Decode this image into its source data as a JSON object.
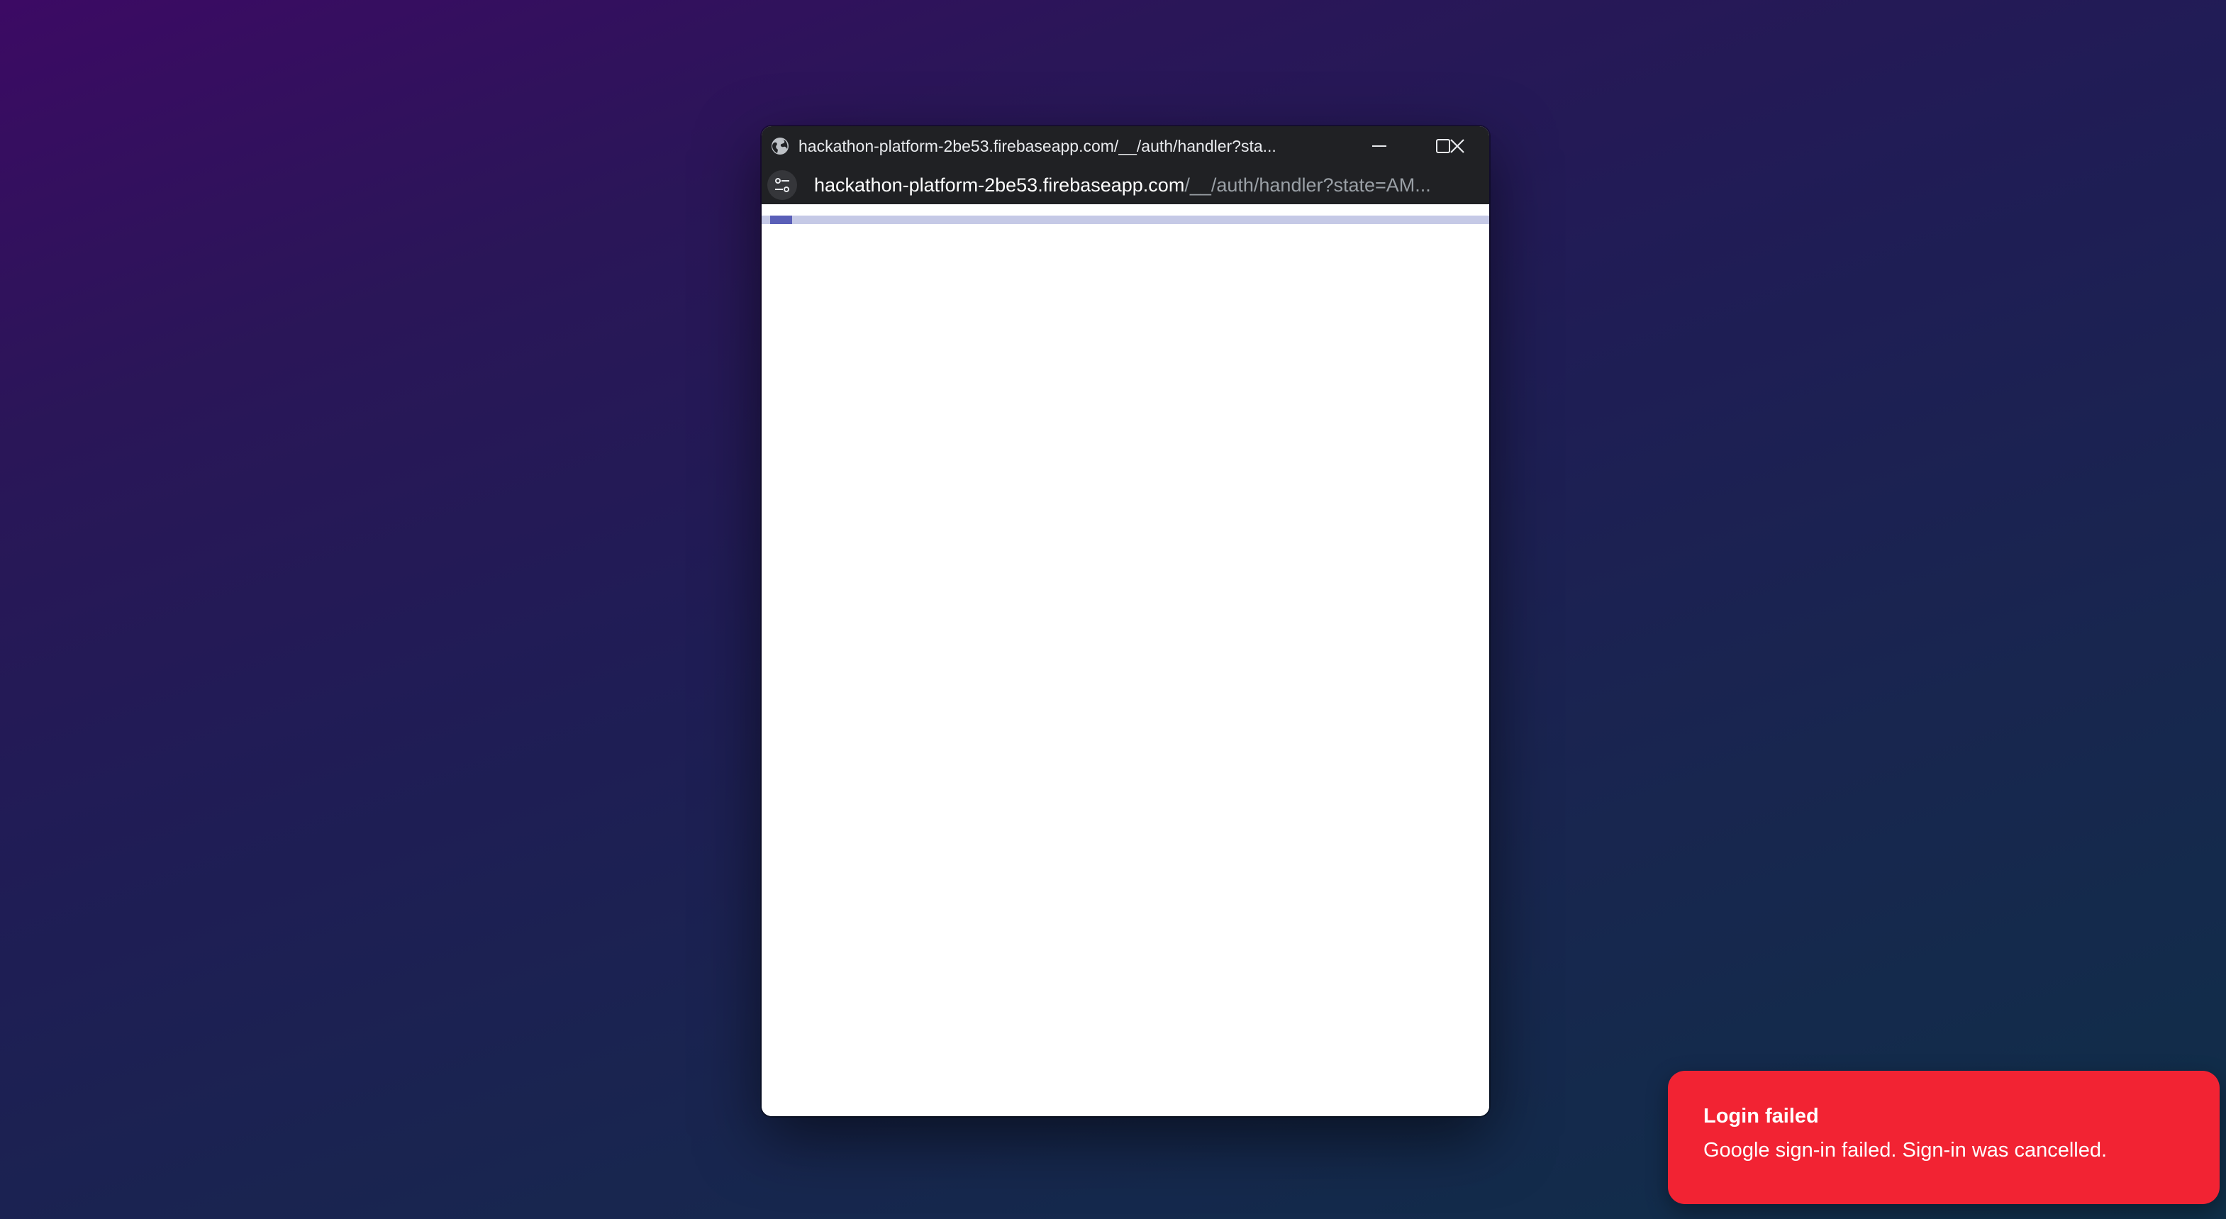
{
  "popup": {
    "window_title": "hackathon-platform-2be53.firebaseapp.com/__/auth/handler?sta...",
    "url_host": "hackathon-platform-2be53.firebaseapp.com",
    "url_path": "/__/auth/handler?state=AM...",
    "loading_progress": 0.03,
    "icons": {
      "site": "globe-icon",
      "site_info": "tune-icon",
      "minimize": "minimize-icon",
      "maximize": "maximize-icon",
      "close": "close-icon"
    }
  },
  "toast": {
    "title": "Login failed",
    "message": "Google sign-in failed. Sign-in was cancelled.",
    "color": "#f22333"
  }
}
